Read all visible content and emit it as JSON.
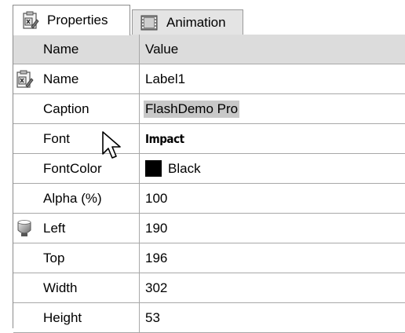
{
  "tabs": {
    "properties_label": "Properties",
    "animation_label": "Animation",
    "active": "Properties"
  },
  "grid": {
    "header": {
      "name": "Name",
      "value": "Value"
    },
    "rows": [
      {
        "name": "Name",
        "value": "Label1",
        "icon": "label-component-icon"
      },
      {
        "name": "Caption",
        "value": "FlashDemo Pro",
        "selected": true
      },
      {
        "name": "Font",
        "value": "Impact"
      },
      {
        "name": "FontColor",
        "value": "Black",
        "swatch": "#000000"
      },
      {
        "name": "Alpha (%)",
        "value": "100"
      },
      {
        "name": "Left",
        "value": "190",
        "icon": "position-knob-icon"
      },
      {
        "name": "Top",
        "value": "196"
      },
      {
        "name": "Width",
        "value": "302"
      },
      {
        "name": "Height",
        "value": "53"
      }
    ]
  },
  "colors": {
    "header_bg": "#dcdcdc",
    "grid_line": "#a8a8a8",
    "selection_bg": "#c8c8c8",
    "inactive_tab_bg": "#e4e4e4"
  },
  "cursor": "mouse-pointer-icon"
}
